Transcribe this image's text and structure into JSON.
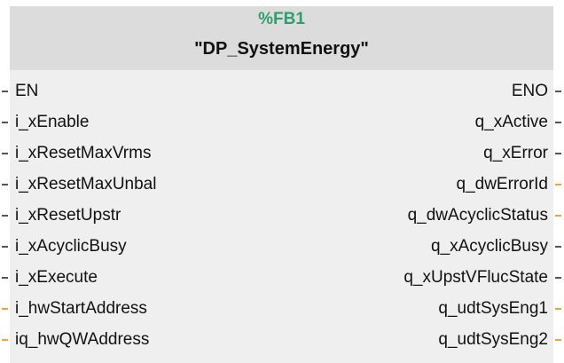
{
  "block": {
    "number": "%FB1",
    "name": "\"DP_SystemEnergy\""
  },
  "colors": {
    "block_number": "#2f9e6c",
    "header_bg": "#dcdcdc",
    "body_bg": "#efefef",
    "stub_default": "#555555",
    "stub_highlight": "#f2a13a"
  },
  "pins": [
    {
      "input": "EN",
      "output": "ENO",
      "in_highlight": false,
      "out_highlight": false
    },
    {
      "input": "i_xEnable",
      "output": "q_xActive",
      "in_highlight": false,
      "out_highlight": false
    },
    {
      "input": "i_xResetMaxVrms",
      "output": "q_xError",
      "in_highlight": false,
      "out_highlight": false
    },
    {
      "input": "i_xResetMaxUnbal",
      "output": "q_dwErrorId",
      "in_highlight": false,
      "out_highlight": true
    },
    {
      "input": "i_xResetUpstr",
      "output": "q_dwAcyclicStatus",
      "in_highlight": false,
      "out_highlight": true
    },
    {
      "input": "i_xAcyclicBusy",
      "output": "q_xAcyclicBusy",
      "in_highlight": false,
      "out_highlight": false
    },
    {
      "input": "i_xExecute",
      "output": "q_xUpstVFlucState",
      "in_highlight": false,
      "out_highlight": false
    },
    {
      "input": "i_hwStartAddress",
      "output": "q_udtSysEng1",
      "in_highlight": true,
      "out_highlight": true
    },
    {
      "input": "iq_hwQWAddress",
      "output": "q_udtSysEng2",
      "in_highlight": true,
      "out_highlight": true
    }
  ]
}
